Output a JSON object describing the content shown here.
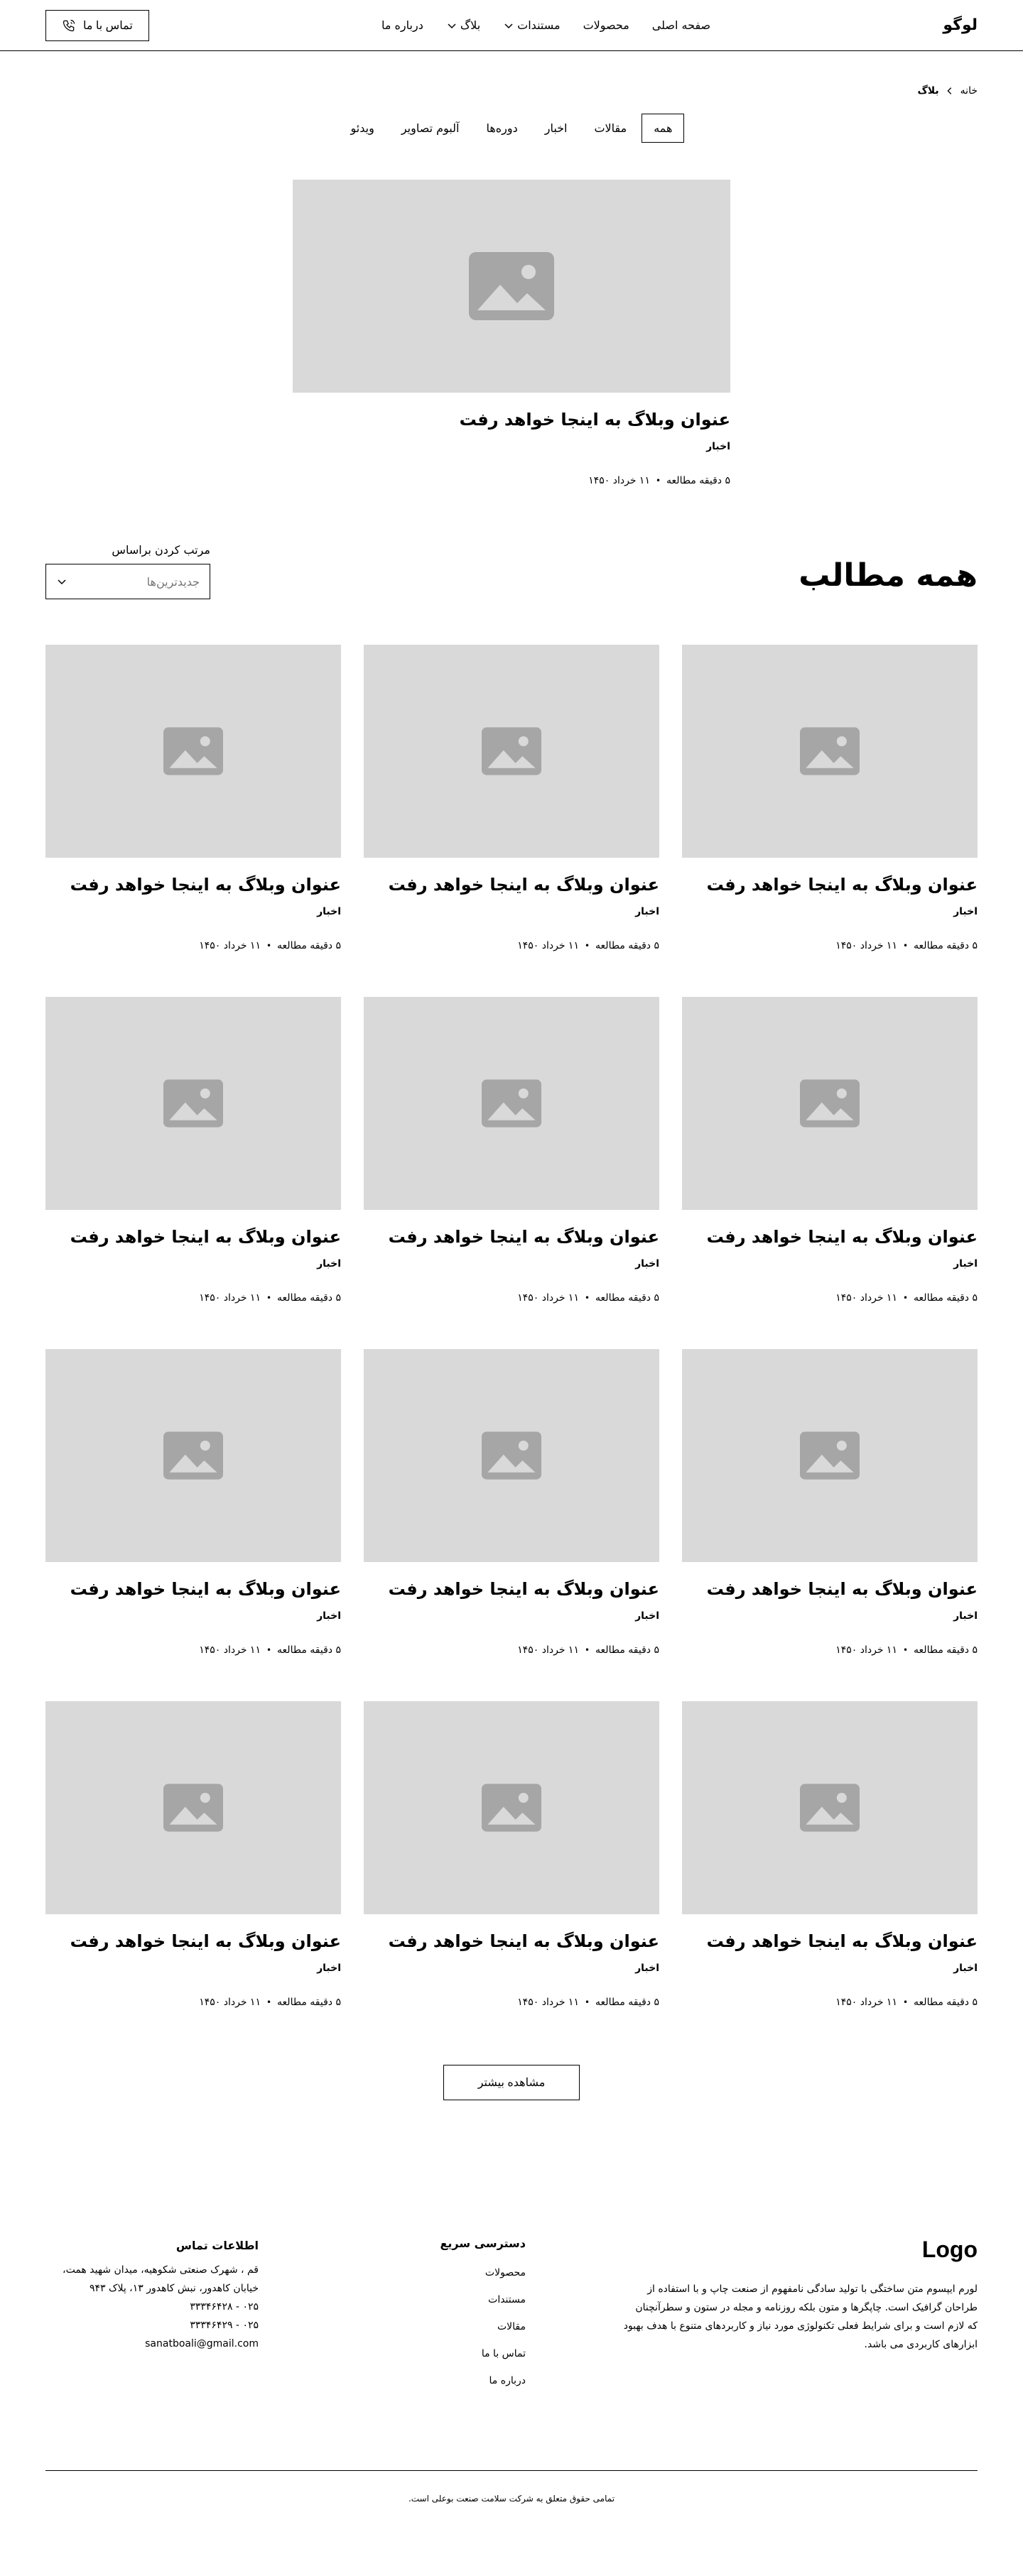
{
  "nav": {
    "logo": "لوگو",
    "links": [
      {
        "label": "صفحه اصلی"
      },
      {
        "label": "محصولات"
      },
      {
        "label": "مستندات"
      },
      {
        "label": "بلاگ"
      },
      {
        "label": "درباره ما"
      }
    ],
    "contact_label": "تماس با ما"
  },
  "breadcrumb": {
    "home": "خانه",
    "current": "بلاگ"
  },
  "tabs": [
    "همه",
    "مقالات",
    "اخبار",
    "دوره‌ها",
    "آلبوم تصاویر",
    "ویدئو"
  ],
  "featured": {
    "title": "عنوان وبلاگ به اینجا خواهد رفت",
    "category": "اخبار",
    "date": "۱۱ خرداد ۱۴۵۰",
    "read": "۵ دقیقه مطالعه"
  },
  "all_posts": {
    "title": "همه مطالب",
    "sort_label": "مرتب کردن براساس",
    "sort_value": "جدیدترین‌ها"
  },
  "posts": {
    "p1": {
      "title": "عنوان وبلاگ به اینجا خواهد رفت",
      "category": "اخبار",
      "date": "۱۱ خرداد ۱۴۵۰",
      "read": "۵ دقیقه مطالعه"
    },
    "p2": {
      "title": "عنوان وبلاگ به اینجا خواهد رفت",
      "category": "اخبار",
      "date": "۱۱ خرداد ۱۴۵۰",
      "read": "۵ دقیقه مطالعه"
    },
    "p3": {
      "title": "عنوان وبلاگ به اینجا خواهد رفت",
      "category": "اخبار",
      "date": "۱۱ خرداد ۱۴۵۰",
      "read": "۵ دقیقه مطالعه"
    },
    "p4": {
      "title": "عنوان وبلاگ به اینجا خواهد رفت",
      "category": "اخبار",
      "date": "۱۱ خرداد ۱۴۵۰",
      "read": "۵ دقیقه مطالعه"
    },
    "p5": {
      "title": "عنوان وبلاگ به اینجا خواهد رفت",
      "category": "اخبار",
      "date": "۱۱ خرداد ۱۴۵۰",
      "read": "۵ دقیقه مطالعه"
    },
    "p6": {
      "title": "عنوان وبلاگ به اینجا خواهد رفت",
      "category": "اخبار",
      "date": "۱۱ خرداد ۱۴۵۰",
      "read": "۵ دقیقه مطالعه"
    },
    "p7": {
      "title": "عنوان وبلاگ به اینجا خواهد رفت",
      "category": "اخبار",
      "date": "۱۱ خرداد ۱۴۵۰",
      "read": "۵ دقیقه مطالعه"
    },
    "p8": {
      "title": "عنوان وبلاگ به اینجا خواهد رفت",
      "category": "اخبار",
      "date": "۱۱ خرداد ۱۴۵۰",
      "read": "۵ دقیقه مطالعه"
    },
    "p9": {
      "title": "عنوان وبلاگ به اینجا خواهد رفت",
      "category": "اخبار",
      "date": "۱۱ خرداد ۱۴۵۰",
      "read": "۵ دقیقه مطالعه"
    },
    "p10": {
      "title": "عنوان وبلاگ به اینجا خواهد رفت",
      "category": "اخبار",
      "date": "۱۱ خرداد ۱۴۵۰",
      "read": "۵ دقیقه مطالعه"
    },
    "p11": {
      "title": "عنوان وبلاگ به اینجا خواهد رفت",
      "category": "اخبار",
      "date": "۱۱ خرداد ۱۴۵۰",
      "read": "۵ دقیقه مطالعه"
    },
    "p12": {
      "title": "عنوان وبلاگ به اینجا خواهد رفت",
      "category": "اخبار",
      "date": "۱۱ خرداد ۱۴۵۰",
      "read": "۵ دقیقه مطالعه"
    }
  },
  "more_label": "مشاهده بیشتر",
  "footer": {
    "logo": "Logo",
    "description": "لورم ایپسوم متن ساختگی با تولید سادگی نامفهوم از صنعت چاپ و با استفاده از طراحان گرافیک است. چاپگرها و متون بلکه روزنامه و مجله در ستون و سطرآنچنان که لازم است و برای شرایط فعلی تکنولوژی مورد نیاز و کاربردهای متنوع با هدف بهبود ابزارهای کاربردی می باشد.",
    "quick_title": "دسترسی سریع",
    "quick_links": [
      "محصولات",
      "مستندات",
      "مقالات",
      "تماس با ما",
      "درباره ما"
    ],
    "contact_title": "اطلاعات تماس",
    "address": "قم ، شهرک صنعتی شکوهیه، میدان شهید همت، خیابان کاهدور، نبش کاهدور ۱۳، پلاک ۹۴۳",
    "phone1": "۰۲۵ - ۳۳۳۴۶۴۲۸",
    "phone2": "۰۲۵ - ۳۳۳۴۶۴۲۹",
    "email": "sanatboali@gmail.com",
    "copyright": "تمامی حقوق متعلق به شرکت سلامت صنعت بوعلی است."
  },
  "colors": {
    "placeholder": "#d9d9d9",
    "placeholder_icon": "#a6a6a6",
    "text": "#000000"
  },
  "icons": [
    "chevron-down-icon",
    "phone-icon",
    "chevron-left-icon",
    "image-placeholder-icon"
  ]
}
